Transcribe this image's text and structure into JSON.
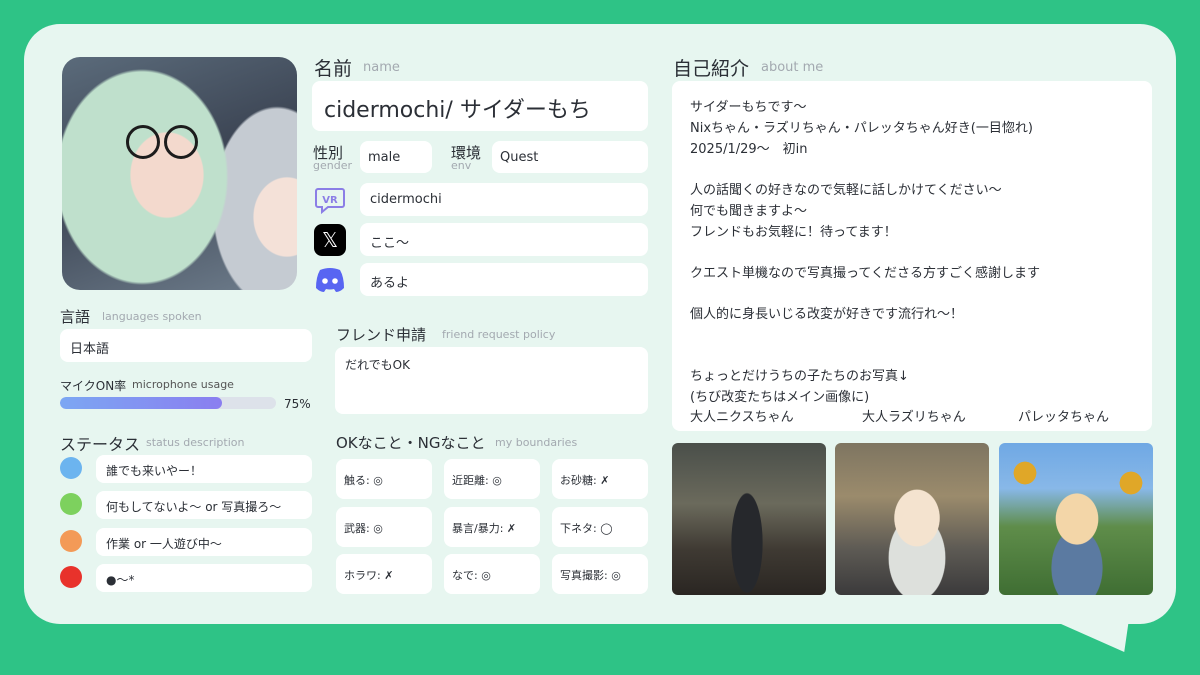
{
  "colors": {
    "background": "#2ec386",
    "card": "#e7f6f0",
    "accent": "#8a7ef0"
  },
  "profile": {
    "name_label": "名前",
    "name_sub": "name",
    "name_value": "cidermochi/ サイダーもち",
    "gender_label": "性別",
    "gender_sub": "gender",
    "gender_value": "male",
    "env_label": "環境",
    "env_sub": "env",
    "env_value": "Quest",
    "vrchat_value": "cidermochi",
    "x_value": "ここ〜",
    "discord_value": "あるよ",
    "icons": [
      "vrchat-icon",
      "x-logo-icon",
      "discord-icon"
    ]
  },
  "languages": {
    "label": "言語",
    "sub": "languages spoken",
    "value": "日本語"
  },
  "mic": {
    "label": "マイクON率",
    "sub": "microphone usage",
    "percent_text": "75%",
    "percent": 75
  },
  "status": {
    "label": "ステータス",
    "sub": "status description",
    "items": [
      {
        "color": "#6cb4ef",
        "text": "誰でも来いやー！"
      },
      {
        "color": "#7dd15e",
        "text": "何もしてないよ〜 or 写真撮ろ〜"
      },
      {
        "color": "#f39a57",
        "text": "作業 or 一人遊び中〜"
      },
      {
        "color": "#e8322b",
        "text": "●〜*"
      }
    ]
  },
  "friend": {
    "label": "フレンド申請",
    "sub": "friend request policy",
    "value": "だれでもOK"
  },
  "boundaries": {
    "label": "OKなこと・NGなこと",
    "sub": "my boundaries",
    "items": [
      "触る: ◎",
      "近距離: ◎",
      "お砂糖: ✗",
      "武器: ◎",
      "暴言/暴力: ✗",
      "下ネタ: ◯",
      "ホラワ: ✗",
      "なで: ◎",
      "写真撮影: ◎"
    ]
  },
  "about": {
    "label": "自己紹介",
    "sub": "about me",
    "lines": [
      "サイダーもちです〜",
      "Nixちゃん・ラズリちゃん・パレッタちゃん好き(一目惚れ)",
      "2025/1/29〜　初in",
      "",
      "人の話聞くの好きなので気軽に話しかけてください〜",
      "何でも聞きますよ〜",
      "フレンドもお気軽に！待ってます！",
      "",
      "クエスト単機なので写真撮ってくださる方すごく感謝します",
      "",
      "個人的に身長いじる改変が好きです流行れ〜！",
      "",
      "",
      "ちょっとだけうちの子たちのお写真↓",
      "(ちび改変たちはメイン画像に)"
    ],
    "captions": [
      "大人ニクスちゃん",
      "大人ラズリちゃん",
      "パレッタちゃん"
    ]
  }
}
